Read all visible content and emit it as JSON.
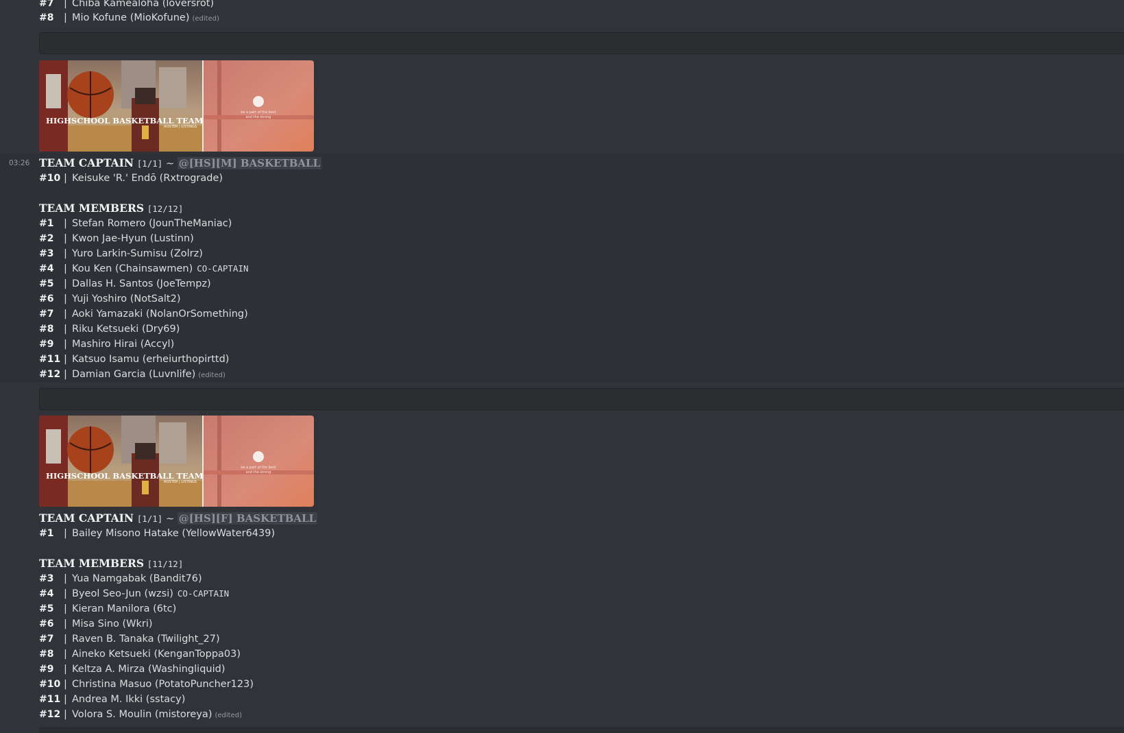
{
  "previous_tail": [
    {
      "num": "#7",
      "name": "Chiba Kamealoha (loversrot)"
    },
    {
      "num": "#8",
      "name": "Mio Kofune (MioKofune)",
      "edited": "(edited)"
    }
  ],
  "banner": {
    "title": "HIGHSCHOOL BASKETBALL TEAM",
    "subtitle": "ROSTER | LISTINGS",
    "tagline_1": "be a part of the best",
    "tagline_2": "and the strong"
  },
  "male_team": {
    "timestamp": "03:26",
    "captain_heading": "TEAM CAPTAIN",
    "captain_count": "[1/1]",
    "tilde": "~",
    "role_mention": "@[HS][M] BASKETBALL",
    "captain": {
      "num": "#10",
      "name": "Keisuke 'R.' Endō (Rxtrograde)"
    },
    "members_heading": "TEAM MEMBERS",
    "members_count": "[12/12]",
    "members": [
      {
        "num": "#1",
        "name": "Stefan Romero (JounTheManiac)"
      },
      {
        "num": "#2",
        "name": "Kwon Jae-Hyun (Lustinn)"
      },
      {
        "num": "#3",
        "name": "Yuro Larkin-Sumisu (Zolrz)"
      },
      {
        "num": "#4",
        "name": "Kou Ken (Chainsawmen)",
        "tag": "CO-CAPTAIN"
      },
      {
        "num": "#5",
        "name": "Dallas H. Santos (JoeTempz)"
      },
      {
        "num": "#6",
        "name": "Yuji Yoshiro (NotSalt2)"
      },
      {
        "num": "#7",
        "name": "Aoki Yamazaki (NolanOrSomething)"
      },
      {
        "num": "#8",
        "name": "Riku Ketsueki (Dry69)"
      },
      {
        "num": "#9",
        "name": "Mashiro  Hirai (Accyl)"
      },
      {
        "num": "#11",
        "name": "Katsuo Isamu (erheiurthopirttd)"
      },
      {
        "num": "#12",
        "name": "Damian Garcia (Luvnlife)",
        "edited": "(edited)"
      }
    ]
  },
  "female_team": {
    "captain_heading": "TEAM CAPTAIN",
    "captain_count": "[1/1]",
    "tilde": "~",
    "role_mention": "@[HS][F] BASKETBALL",
    "captain": {
      "num": "#1",
      "name": "Bailey Misono Hatake (YellowWater6439)"
    },
    "members_heading": "TEAM MEMBERS",
    "members_count": "[11/12]",
    "members": [
      {
        "num": "#3",
        "name": "Yua Namgabak (Bandit76)"
      },
      {
        "num": "#4",
        "name": "Byeol Seo-Jun (wzsi)",
        "tag": "CO-CAPTAIN"
      },
      {
        "num": "#5",
        "name": "Kieran Manilora (6tc)"
      },
      {
        "num": "#6",
        "name": "Misa Sino (Wkri)"
      },
      {
        "num": "#7",
        "name": "Raven B. Tanaka (Twilight_27)"
      },
      {
        "num": "#8",
        "name": "Aineko Ketsueki (KenganToppa03)"
      },
      {
        "num": "#9",
        "name": "Keltza A. Mirza (Washingliquid)"
      },
      {
        "num": "#10",
        "name": "Christina Masuo (PotatoPuncher123)"
      },
      {
        "num": "#11",
        "name": "Andrea M. Ikki (sstacy)"
      },
      {
        "num": "#12",
        "name": "Volora S. Moulin (mistoreya)",
        "edited": "(edited)"
      }
    ]
  }
}
